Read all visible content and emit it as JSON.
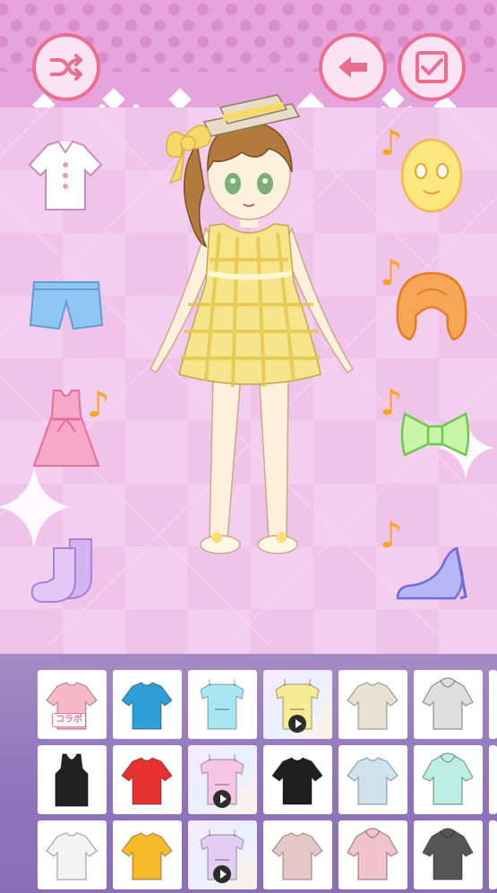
{
  "top_buttons": {
    "shuffle": {
      "icon": "shuffle-icon"
    },
    "back": {
      "icon": "arrow-left-icon"
    },
    "confirm": {
      "icon": "checkbox-checked-icon"
    }
  },
  "categories_left": [
    {
      "icon": "blouse-icon",
      "music": false
    },
    {
      "icon": "shorts-icon",
      "music": false
    },
    {
      "icon": "dress-icon",
      "music": true
    },
    {
      "icon": "socks-icon",
      "music": false
    }
  ],
  "categories_right": [
    {
      "icon": "face-icon",
      "music": true
    },
    {
      "icon": "hair-icon",
      "music": true
    },
    {
      "icon": "bow-icon",
      "music": true
    },
    {
      "icon": "heel-shoe-icon",
      "music": true
    }
  ],
  "music_note_glyph": "♪",
  "item_grid": [
    [
      {
        "icon": "pink-sweater-icon",
        "color": "#f7b9c8",
        "badge": "コラボ",
        "video": false
      },
      {
        "icon": "blue-shirt-icon",
        "color": "#2e9ed6",
        "badge": "",
        "video": false
      },
      {
        "icon": "cyan-offshoulder-top-icon",
        "color": "#a8e6f2",
        "badge": "",
        "video": false
      },
      {
        "icon": "yellow-offshoulder-top-icon",
        "color": "#f6ea95",
        "badge": "",
        "video": true
      },
      {
        "icon": "beige-shirt-icon",
        "color": "#e9e1d3",
        "badge": "",
        "video": false
      },
      {
        "icon": "gray-hoodie-icon",
        "color": "#dedede",
        "badge": "",
        "video": false
      }
    ],
    [
      {
        "icon": "black-tank-top-icon",
        "color": "#222222",
        "badge": "",
        "video": false
      },
      {
        "icon": "red-shirt-icon",
        "color": "#e5322e",
        "badge": "",
        "video": false
      },
      {
        "icon": "pink-offshoulder-top-icon",
        "color": "#f7c6e6",
        "badge": "",
        "video": true
      },
      {
        "icon": "black-long-sleeve-icon",
        "color": "#1f1f1f",
        "badge": "",
        "video": false
      },
      {
        "icon": "light-blue-shirt-icon",
        "color": "#cfe3ee",
        "badge": "",
        "video": false
      },
      {
        "icon": "mint-hoodie-icon",
        "color": "#bdeee3",
        "badge": "",
        "video": false
      }
    ],
    [
      {
        "icon": "white-shirt-icon",
        "color": "#f4f4f4",
        "badge": "",
        "video": false
      },
      {
        "icon": "yellow-shirt-icon",
        "color": "#f5b92a",
        "badge": "",
        "video": false
      },
      {
        "icon": "lavender-offshoulder-top-icon",
        "color": "#e3cdf3",
        "badge": "",
        "video": true
      },
      {
        "icon": "pink-gray-shirt-icon",
        "color": "#e6c7c7",
        "badge": "",
        "video": false
      },
      {
        "icon": "pink-hoodie-icon",
        "color": "#f2c3cd",
        "badge": "",
        "video": false
      },
      {
        "icon": "black-gray-hoodie-icon",
        "color": "#555555",
        "badge": "",
        "video": false
      }
    ]
  ],
  "colors": {
    "banner": "#e6a4dc",
    "button_border": "#ec6e8e",
    "button_fill": "#fbe3f3",
    "panel": "#9a7fc0",
    "note": "#f5a81c"
  }
}
